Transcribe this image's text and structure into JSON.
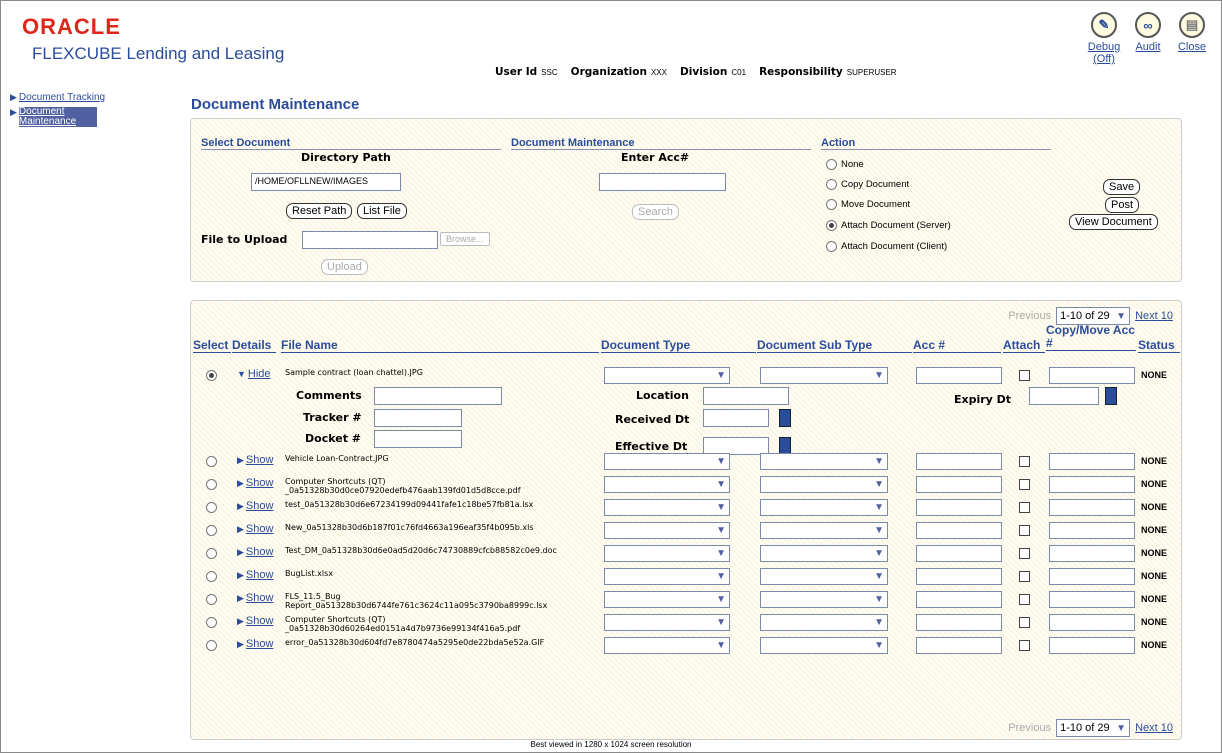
{
  "header": {
    "oracle": "ORACLE",
    "product": "FLEXCUBE Lending and Leasing",
    "user_id_label": "User Id",
    "user_id": "SSC",
    "org_label": "Organization",
    "org": "XXX",
    "div_label": "Division",
    "div": "C01",
    "resp_label": "Responsibility",
    "resp": "SUPERUSER",
    "debug": "Debug (Off)",
    "audit": "Audit",
    "close": "Close"
  },
  "sidebar": {
    "items": [
      {
        "label": "Document Tracking"
      },
      {
        "label": "Document Maintenance"
      }
    ]
  },
  "main": {
    "title": "Document Maintenance",
    "select_document": "Select Document",
    "doc_maint": "Document Maintenance",
    "action": "Action",
    "dir_path_label": "Directory Path",
    "dir_path_value": "/HOME/OFLLNEW/IMAGES",
    "reset_path": "Reset Path",
    "list_file": "List File",
    "file_to_upload": "File to Upload",
    "browse": "Browse...",
    "upload": "Upload",
    "enter_acc": "Enter Acc#",
    "search": "Search",
    "actions": [
      "None",
      "Copy Document",
      "Move Document",
      "Attach Document (Server)",
      "Attach Document (Client)"
    ],
    "save": "Save",
    "post": "Post",
    "view_document": "View Document"
  },
  "pager": {
    "prev": "Previous",
    "range": "1-10 of 29",
    "next": "Next 10"
  },
  "columns": {
    "select": "Select",
    "details": "Details",
    "file": "File Name",
    "doc_type": "Document Type",
    "doc_sub": "Document Sub Type",
    "acc": "Acc #",
    "attach": "Attach",
    "copy_move": "Copy/Move Acc #",
    "status": "Status"
  },
  "details_panel": {
    "comments": "Comments",
    "tracker": "Tracker #",
    "docket": "Docket #",
    "location": "Location",
    "received": "Received Dt",
    "effective": "Effective Dt",
    "expiry": "Expiry Dt"
  },
  "rows": [
    {
      "link": "Hide",
      "file": "Sample contract (loan chattel).JPG",
      "status": "NONE"
    },
    {
      "link": "Show",
      "file": "Vehicle Loan-Contract.JPG",
      "status": "NONE"
    },
    {
      "link": "Show",
      "file": "Computer Shortcuts (QT) _0a51328b30d0ce07920edefb476aab139fd01d5d8cce.pdf",
      "status": "NONE"
    },
    {
      "link": "Show",
      "file": "test_0a51328b30d6e67234199d09441fafe1c18be57fb81a.lsx",
      "status": "NONE"
    },
    {
      "link": "Show",
      "file": "New_0a51328b30d6b187f01c76fd4663a196eaf35f4b095b.xls",
      "status": "NONE"
    },
    {
      "link": "Show",
      "file": "Test_DM_0a51328b30d6e0ad5d20d6c74730889cfcb88582c0e9.doc",
      "status": "NONE"
    },
    {
      "link": "Show",
      "file": "BugList.xlsx",
      "status": "NONE"
    },
    {
      "link": "Show",
      "file": "FLS_11.5_Bug Report_0a51328b30d6744fe761c3624c11a095c3790ba8999c.lsx",
      "status": "NONE"
    },
    {
      "link": "Show",
      "file": "Computer Shortcuts (QT) _0a51328b30d60264ed0151a4d7b9736e99134f416a5.pdf",
      "status": "NONE"
    },
    {
      "link": "Show",
      "file": "error_0a51328b30d604fd7e8780474a5295e0de22bda5e52a.GIF",
      "status": "NONE"
    }
  ],
  "footer": "Best viewed in 1280 x 1024 screen resolution"
}
